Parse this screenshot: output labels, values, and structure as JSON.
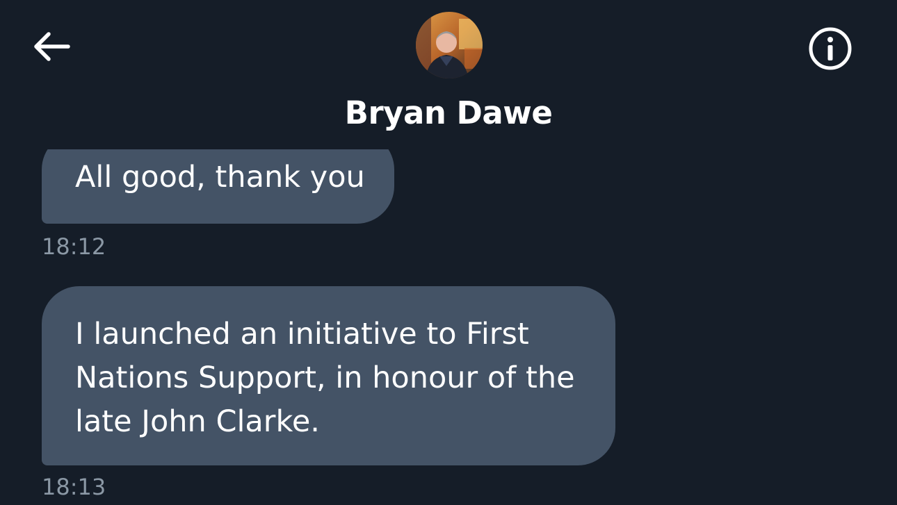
{
  "conversation": {
    "contact_name": "Bryan Dawe",
    "avatar_icon": "contact-avatar-photo",
    "back_icon": "arrow-left-icon",
    "info_icon": "info-circle-icon"
  },
  "messages": [
    {
      "text": "All good, thank you",
      "time": "18:12"
    },
    {
      "text": "I launched an initiative to First Nations Support, in honour of the late John Clarke.",
      "time": "18:13"
    }
  ],
  "colors": {
    "background": "#151d28",
    "bubble": "#445366",
    "timestamp": "#8b98a5",
    "text": "#ffffff"
  }
}
